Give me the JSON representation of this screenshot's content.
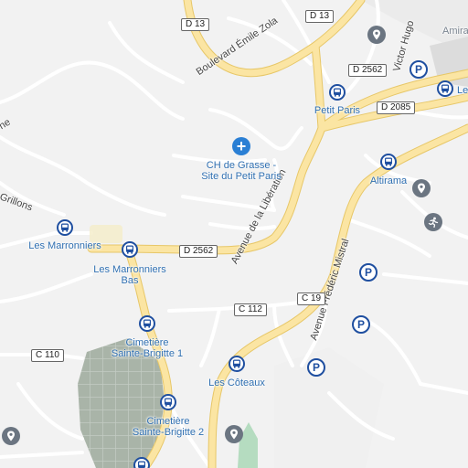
{
  "map": {
    "road_labels": {
      "boulevard_emile_zola": "Boulevard Émile Zola",
      "avenue_liberation": "Avenue de la Libération",
      "avenue_frederic_mistral": "Avenue Frédéric Mistral",
      "victor_hugo": "Victor Hugo",
      "grillons": "Grillons",
      "partial_ne": "ne"
    },
    "shields": {
      "d13_a": "D 13",
      "d13_b": "D 13",
      "d2562_a": "D 2562",
      "d2085": "D 2085",
      "d2562_b": "D 2562",
      "c112": "C 112",
      "c19": "C 19",
      "c110": "C 110"
    },
    "places": {
      "hospital": "CH de Grasse - Site du Petit Paris",
      "petit_paris": "Petit Paris",
      "altirama": "Altirama",
      "les_marronniers": "Les Marronniers",
      "les_marronniers_bas": "Les Marronniers Bas",
      "cimetiere_sb1": "Cimetière Sainte-Brigitte 1",
      "cimetiere_sb2": "Cimetière Sainte-Brigitte 2",
      "les_coteaux": "Les Côteaux",
      "amira": "Amira",
      "le": "Le"
    },
    "colors": {
      "background": "#f2f2f2",
      "road_major": "#fbe5a3",
      "road_major_outline": "#e7c768",
      "road_minor": "#ffffff",
      "cemetery": "#a9b4a8",
      "park": "#b5dcc0",
      "poi_label": "#2f6fb1",
      "transit": "#1f4fa0"
    },
    "icons": [
      "bus-stop-icon",
      "parking-icon",
      "place-pin-icon",
      "hospital-cross-icon",
      "sport-icon"
    ]
  }
}
